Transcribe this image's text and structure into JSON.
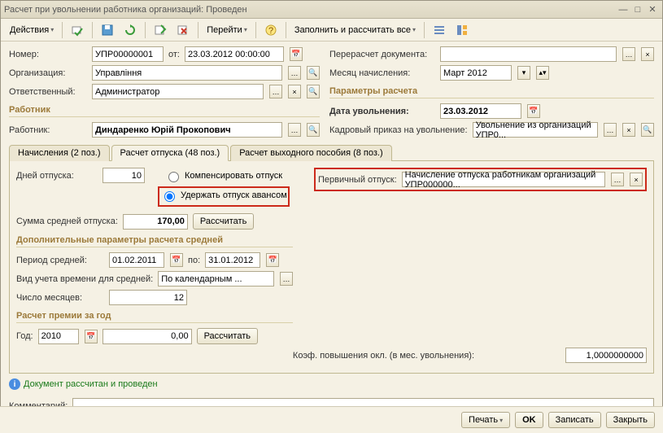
{
  "window": {
    "title": "Расчет при увольнении работника организаций: Проведен"
  },
  "toolbar": {
    "actions": "Действия",
    "goto": "Перейти",
    "fill": "Заполнить и рассчитать все"
  },
  "header": {
    "number_lbl": "Номер:",
    "number": "УПР00000001",
    "from_lbl": "от:",
    "date": "23.03.2012 00:00:00",
    "org_lbl": "Организация:",
    "org": "Управління",
    "resp_lbl": "Ответственный:",
    "resp": "Администратор",
    "recalc_lbl": "Перерасчет документа:",
    "recalc": "",
    "month_lbl": "Месяц начисления:",
    "month": "Март 2012"
  },
  "employee": {
    "group": "Работник",
    "lbl": "Работник:",
    "name": "Диндаренко Юрій Прокопович"
  },
  "params": {
    "group": "Параметры расчета",
    "fire_date_lbl": "Дата увольнения:",
    "fire_date": "23.03.2012",
    "order_lbl": "Кадровый приказ на увольнение:",
    "order": "Увольнение из организаций УПР0..."
  },
  "tabs": {
    "t1": "Начисления (2 поз.)",
    "t2": "Расчет отпуска (48 поз.)",
    "t3": "Расчет выходного пособия (8 поз.)"
  },
  "vacation": {
    "days_lbl": "Дней отпуска:",
    "days": "10",
    "r1": "Компенсировать отпуск",
    "r2": "Удержать отпуск авансом",
    "primary_lbl": "Первичный отпуск:",
    "primary": "Начисление отпуска работникам организаций УПР000000...",
    "avg_sum_lbl": "Сумма средней отпуска:",
    "avg_sum": "170,00",
    "calc_btn": "Рассчитать"
  },
  "avg": {
    "group": "Дополнительные параметры расчета средней",
    "period_lbl": "Период средней:",
    "from": "01.02.2011",
    "to_lbl": "по:",
    "to": "31.01.2012",
    "kind_lbl": "Вид учета времени для средней:",
    "kind": "По календарным ...",
    "months_lbl": "Число месяцев:",
    "months": "12"
  },
  "bonus": {
    "group": "Расчет премии за год",
    "year_lbl": "Год:",
    "year": "2010",
    "amount": "0,00",
    "calc_btn": "Рассчитать"
  },
  "coef": {
    "lbl": "Коэф. повышения окл. (в мес. увольнения):",
    "val": "1,0000000000"
  },
  "status": "Документ рассчитан и проведен",
  "comment": {
    "lbl": "Комментарий:",
    "val": ""
  },
  "footer": {
    "print": "Печать",
    "ok": "OK",
    "write": "Записать",
    "close": "Закрыть"
  }
}
